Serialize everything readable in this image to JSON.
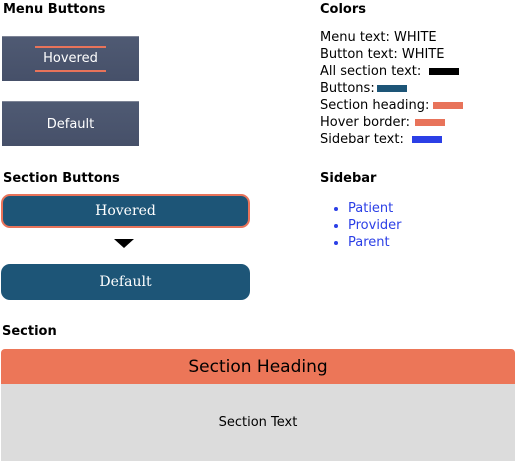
{
  "menu_buttons": {
    "title": "Menu Buttons",
    "hovered_label": "Hovered",
    "default_label": "Default"
  },
  "section_buttons": {
    "title": "Section Buttons",
    "hovered_label": "Hovered",
    "default_label": "Default"
  },
  "colors": {
    "title": "Colors",
    "rows": [
      {
        "label": "Menu text: WHITE",
        "swatch": ""
      },
      {
        "label": "Button text: WHITE",
        "swatch": ""
      },
      {
        "label": "All section text:",
        "swatch": "#000000"
      },
      {
        "label": "Buttons:",
        "swatch": "#1d5577"
      },
      {
        "label": "Section heading:",
        "swatch": "#e8735a"
      },
      {
        "label": "Hover border:",
        "swatch": "#e8735a"
      },
      {
        "label": "Sidebar text:",
        "swatch": "#2b3fe6"
      }
    ]
  },
  "sidebar": {
    "title": "Sidebar",
    "items": [
      "Patient",
      "Provider",
      "Parent"
    ],
    "text_color": "#2b3fe6"
  },
  "section": {
    "title": "Section",
    "heading": "Section Heading",
    "text": "Section Text",
    "heading_color": "#ec7658"
  },
  "theme": {
    "button_blue": "#1d5577",
    "accent_orange": "#e8735a",
    "menu_gray": "#4f5a73"
  }
}
